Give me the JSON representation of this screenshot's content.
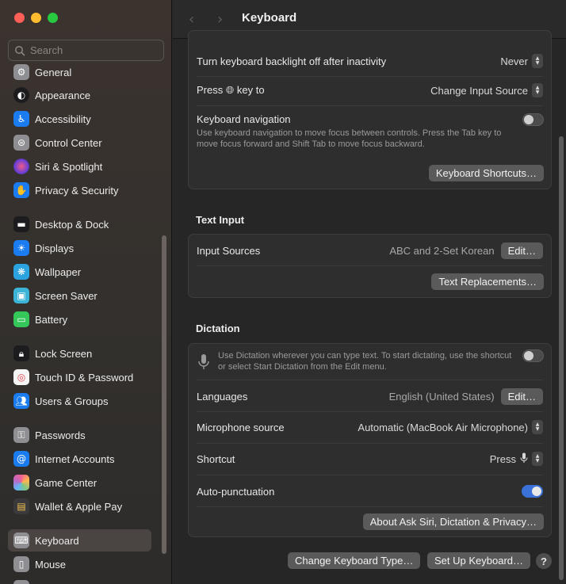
{
  "search": {
    "placeholder": "Search"
  },
  "sidebar": {
    "items": [
      {
        "label": "General",
        "icon": "gear-icon",
        "color": "#8e8e93"
      },
      {
        "label": "Appearance",
        "icon": "appearance-icon",
        "color": "#1c1c1e"
      },
      {
        "label": "Accessibility",
        "icon": "accessibility-icon",
        "color": "#1a7cf0"
      },
      {
        "label": "Control Center",
        "icon": "control-center-icon",
        "color": "#8e8e93"
      },
      {
        "label": "Siri & Spotlight",
        "icon": "siri-icon",
        "color": "#8b3fd6"
      },
      {
        "label": "Privacy & Security",
        "icon": "hand-icon",
        "color": "#1a7cf0"
      },
      {
        "label": "Desktop & Dock",
        "icon": "dock-icon",
        "color": "#1c1c1e"
      },
      {
        "label": "Displays",
        "icon": "sun-icon",
        "color": "#1a7cf0"
      },
      {
        "label": "Wallpaper",
        "icon": "wallpaper-icon",
        "color": "#2ba3e0"
      },
      {
        "label": "Screen Saver",
        "icon": "screen-saver-icon",
        "color": "#3bb4d8"
      },
      {
        "label": "Battery",
        "icon": "battery-icon",
        "color": "#34c759"
      },
      {
        "label": "Lock Screen",
        "icon": "lock-icon",
        "color": "#1c1c1e"
      },
      {
        "label": "Touch ID & Password",
        "icon": "fingerprint-icon",
        "color": "#f5f5f5"
      },
      {
        "label": "Users & Groups",
        "icon": "users-icon",
        "color": "#1a7cf0"
      },
      {
        "label": "Passwords",
        "icon": "key-icon",
        "color": "#8e8e93"
      },
      {
        "label": "Internet Accounts",
        "icon": "at-icon",
        "color": "#1a7cf0"
      },
      {
        "label": "Game Center",
        "icon": "game-center-icon",
        "color": "#f5f5f5"
      },
      {
        "label": "Wallet & Apple Pay",
        "icon": "wallet-icon",
        "color": "#3a3a3c"
      },
      {
        "label": "Keyboard",
        "icon": "keyboard-icon",
        "color": "#8e8e93"
      },
      {
        "label": "Mouse",
        "icon": "mouse-icon",
        "color": "#8e8e93"
      }
    ],
    "active": "Keyboard"
  },
  "header": {
    "title": "Keyboard"
  },
  "keyboard_panel": {
    "backlight_label": "Turn keyboard backlight off after inactivity",
    "backlight_value": "Never",
    "press_label_prefix": "Press",
    "press_label_suffix": "key to",
    "press_value": "Change Input Source",
    "nav_label": "Keyboard navigation",
    "nav_desc": "Use keyboard navigation to move focus between controls. Press the Tab key to move focus forward and Shift Tab to move focus backward.",
    "nav_enabled": false,
    "shortcuts_button": "Keyboard Shortcuts…"
  },
  "text_input": {
    "section_title": "Text Input",
    "sources_label": "Input Sources",
    "sources_value": "ABC and 2-Set Korean",
    "edit_button": "Edit…",
    "replacements_button": "Text Replacements…"
  },
  "dictation": {
    "section_title": "Dictation",
    "desc": "Use Dictation wherever you can type text. To start dictating, use the shortcut or select Start Dictation from the Edit menu.",
    "enabled": false,
    "languages_label": "Languages",
    "languages_value": "English (United States)",
    "edit_button": "Edit…",
    "mic_label": "Microphone source",
    "mic_value": "Automatic (MacBook Air Microphone)",
    "shortcut_label": "Shortcut",
    "shortcut_value": "Press",
    "autopunct_label": "Auto-punctuation",
    "autopunct_enabled": true,
    "about_button": "About Ask Siri, Dictation & Privacy…"
  },
  "footer": {
    "change_type_button": "Change Keyboard Type…",
    "setup_button": "Set Up Keyboard…",
    "help_label": "?"
  },
  "colors": {
    "accent": "#3a72d9"
  }
}
